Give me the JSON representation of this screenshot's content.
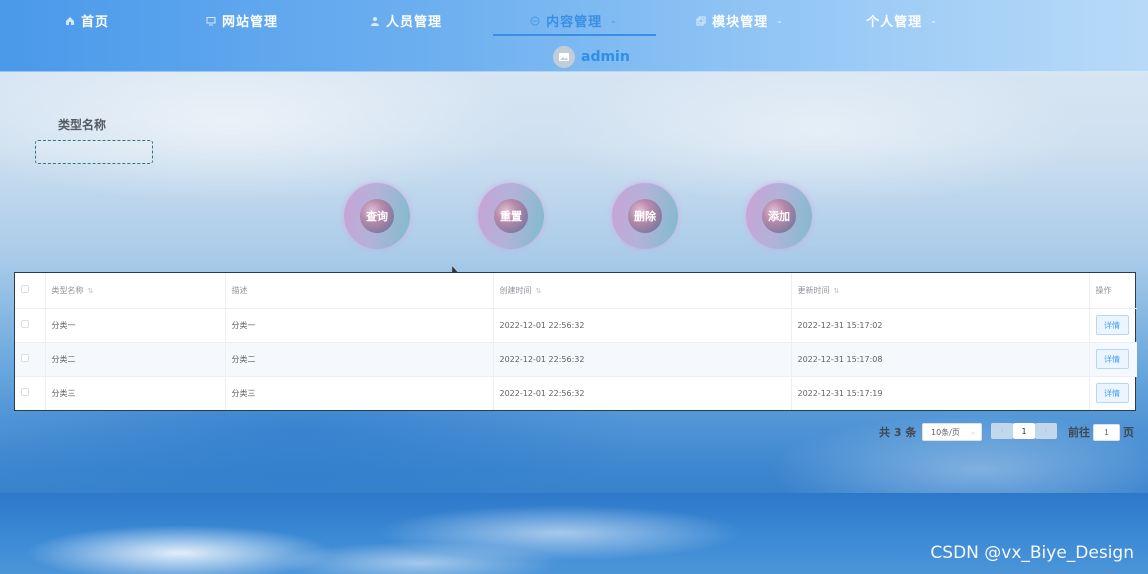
{
  "nav": {
    "items": [
      {
        "label": "首页",
        "icon": "home-icon",
        "active": false,
        "dropdown": false
      },
      {
        "label": "网站管理",
        "icon": "monitor-icon",
        "active": false,
        "dropdown": false
      },
      {
        "label": "人员管理",
        "icon": "user-icon",
        "active": false,
        "dropdown": false
      },
      {
        "label": "内容管理",
        "icon": "content-icon",
        "active": true,
        "dropdown": true
      },
      {
        "label": "模块管理",
        "icon": "copy-icon",
        "active": false,
        "dropdown": true
      },
      {
        "label": "个人管理",
        "icon": "person-icon",
        "active": false,
        "dropdown": true
      }
    ],
    "username": "admin"
  },
  "search": {
    "label": "类型名称",
    "value": ""
  },
  "actions": {
    "query": "查询",
    "reset": "重置",
    "delete": "删除",
    "add": "添加"
  },
  "table": {
    "headers": [
      "类型名称",
      "描述",
      "创建时间",
      "更新时间",
      "操作"
    ],
    "rows": [
      {
        "name": "分类一",
        "desc": "分类一",
        "created": "2022-12-01 22:56:32",
        "updated": "2022-12-31 15:17:02",
        "action": "详情"
      },
      {
        "name": "分类二",
        "desc": "分类二",
        "created": "2022-12-01 22:56:32",
        "updated": "2022-12-31 15:17:08",
        "action": "详情"
      },
      {
        "name": "分类三",
        "desc": "分类三",
        "created": "2022-12-01 22:56:32",
        "updated": "2022-12-31 15:17:19",
        "action": "详情"
      }
    ]
  },
  "pagination": {
    "total": "共 3 条",
    "page_size": "10条/页",
    "current_page": "1",
    "goto_label": "前往",
    "goto_value": "1",
    "page_unit": "页"
  },
  "watermark": "CSDN @vx_Biye_Design",
  "colors": {
    "accent": "#3a8ee6",
    "nav_start": "#4a99ea",
    "input_border": "#2c7a7b"
  }
}
